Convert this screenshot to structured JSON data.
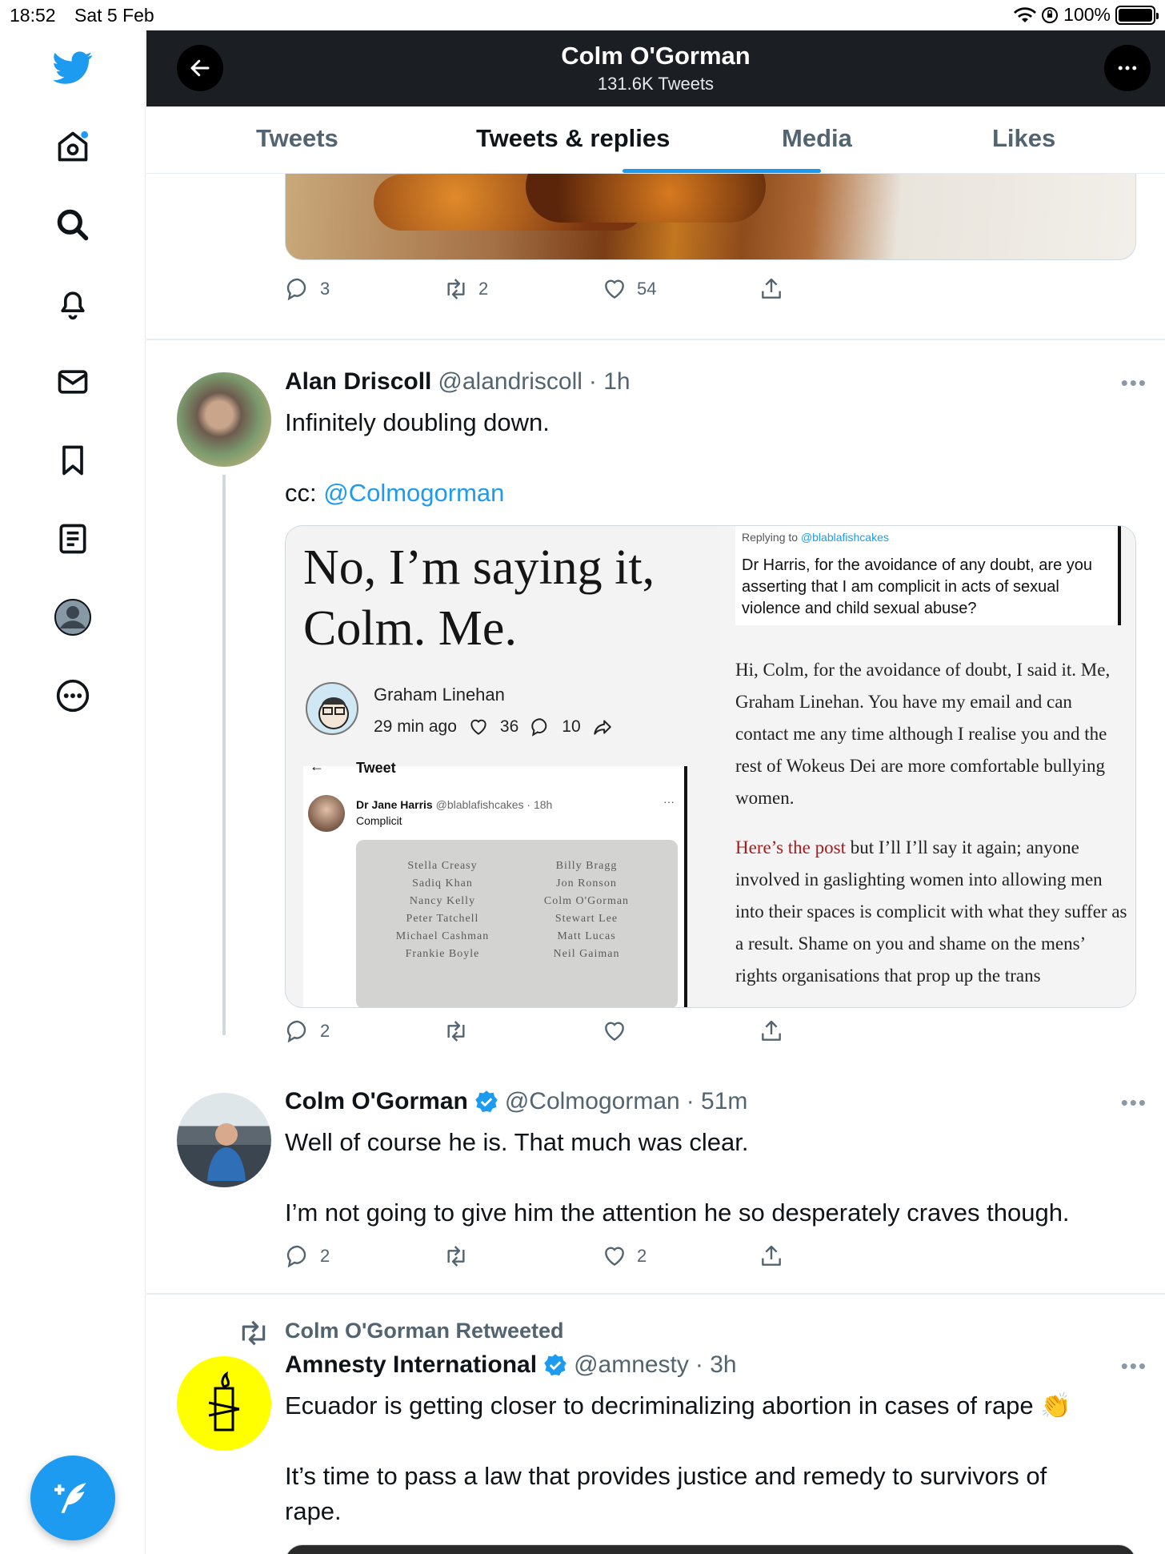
{
  "status_bar": {
    "time": "18:52",
    "date": "Sat 5 Feb",
    "battery": "100%"
  },
  "header": {
    "title": "Colm O'Gorman",
    "subtitle": "131.6K Tweets"
  },
  "tabs": [
    {
      "label": "Tweets",
      "active": false
    },
    {
      "label": "Tweets & replies",
      "active": true
    },
    {
      "label": "Media",
      "active": false
    },
    {
      "label": "Likes",
      "active": false
    }
  ],
  "sidebar": {
    "items": [
      "twitter-logo",
      "home-icon",
      "search-icon",
      "notifications-icon",
      "messages-icon",
      "bookmarks-icon",
      "lists-icon",
      "profile-icon",
      "more-icon"
    ]
  },
  "colors": {
    "accent": "#1d9bf0",
    "header_bg": "#1b1f23",
    "text": "#0f1419",
    "muted": "#536471"
  },
  "tweet0": {
    "actions": {
      "replies": "3",
      "retweets": "2",
      "likes": "54"
    }
  },
  "tweet1": {
    "name": "Alan Driscoll",
    "handle": "@alandriscoll",
    "time": "· 1h",
    "text_line1": "Infinitely doubling down.",
    "text_cc_prefix": "cc:",
    "text_cc_link": "@Colmogorman",
    "media": {
      "headline_line1": "No, I’m saying it,",
      "headline_line2": "Colm. Me.",
      "author": "Graham Linehan",
      "meta_time": "29 min ago",
      "meta_likes": "36",
      "meta_comments": "10",
      "inner_header": "Tweet",
      "inner_name": "Dr Jane Harris",
      "inner_handle": "@blablafishcakes · 18h",
      "inner_text": "Complicit",
      "plaque_left": [
        "Stella Creasy",
        "Sadiq Khan",
        "Nancy Kelly",
        "Peter Tatchell",
        "Michael Cashman",
        "Frankie Boyle"
      ],
      "plaque_right": [
        "Billy Bragg",
        "Jon Ronson",
        "Colm O'Gorman",
        "Stewart Lee",
        "Matt Lucas",
        "Neil Gaiman"
      ],
      "reply_to_prefix": "Replying to",
      "reply_to_handle": "@blablafishcakes",
      "reply_question": "Dr Harris, for the avoidance of any doubt, are you asserting that I am complicit in acts of sexual violence and child sexual abuse?",
      "para1": "Hi, Colm, for the avoidance of doubt, I said it. Me, Graham Linehan. You have my email and can contact me any time although I realise you and the rest of Wokeus Dei are more comfortable bullying women.",
      "para2_link": "Here’s the post",
      "para2": " but I’ll I’ll say it again; anyone involved in gaslighting women into allowing men into their spaces is complicit with what they suffer as a result. Shame on you and shame on the mens’ rights organisations that prop up the trans"
    },
    "actions": {
      "replies": "2",
      "retweets": "",
      "likes": ""
    }
  },
  "tweet2": {
    "name": "Colm O'Gorman",
    "handle": "@Colmogorman",
    "time": "· 51m",
    "text_line1": "Well of course he is. That much was clear.",
    "text_line2": "I’m not going to give him the attention he so desperately craves though.",
    "actions": {
      "replies": "2",
      "retweets": "",
      "likes": "2"
    }
  },
  "tweet3": {
    "retweeted_by": "Colm O'Gorman Retweeted",
    "name": "Amnesty International",
    "handle": "@amnesty",
    "time": "· 3h",
    "text_line1": "Ecuador is getting closer to decriminalizing abortion in cases of rape 👏",
    "text_line2": "It’s time to pass a law that provides justice and remedy to survivors of",
    "text_line3": "rape."
  }
}
